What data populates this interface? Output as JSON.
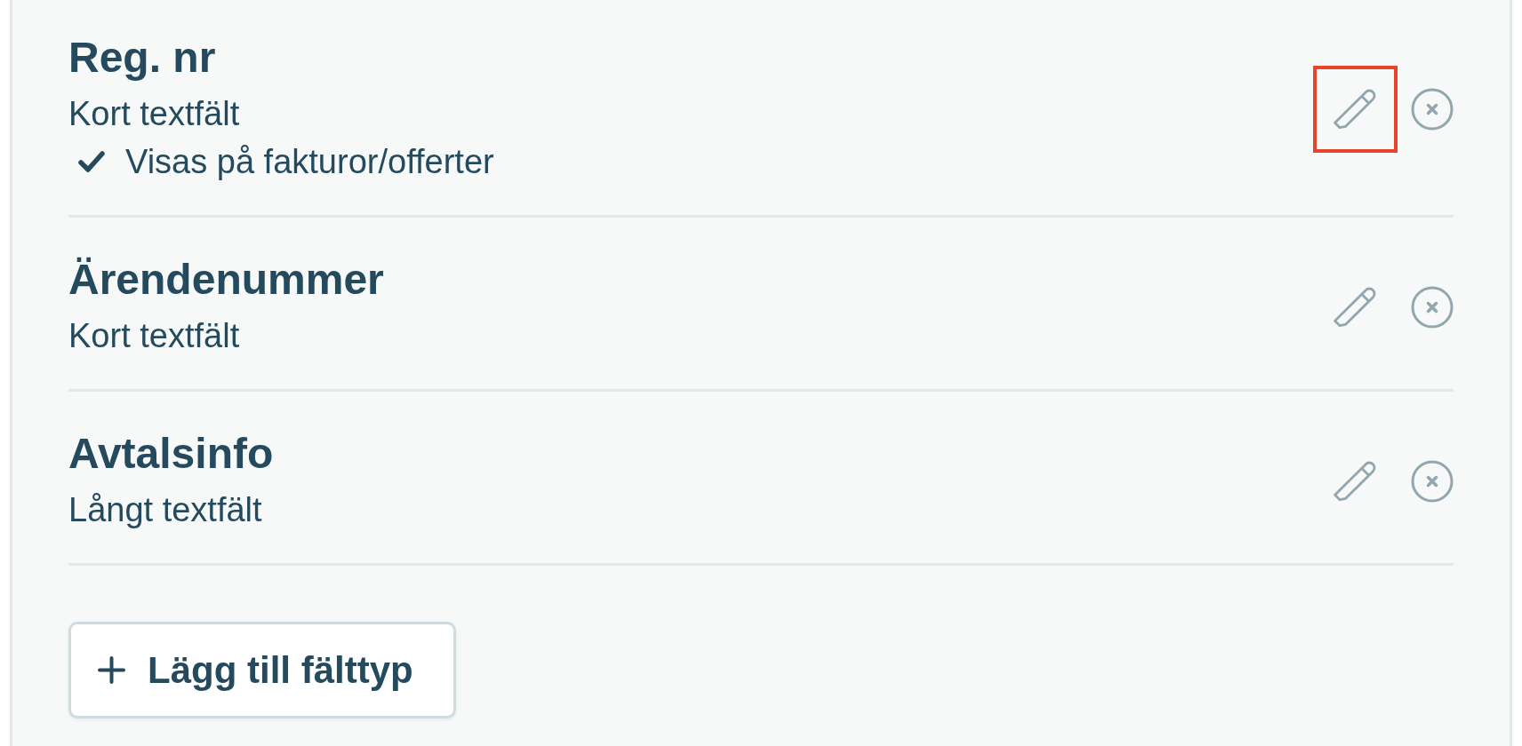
{
  "fields": [
    {
      "name": "Reg. nr",
      "type": "Kort textfält",
      "options": [
        {
          "label": "Visas på fakturor/offerter",
          "checked": true
        }
      ],
      "edit_highlighted": true
    },
    {
      "name": "Ärendenummer",
      "type": "Kort textfält",
      "edit_highlighted": false
    },
    {
      "name": "Avtalsinfo",
      "type": "Långt textfält",
      "edit_highlighted": false
    }
  ],
  "add_button": {
    "label": "Lägg till fälttyp"
  }
}
